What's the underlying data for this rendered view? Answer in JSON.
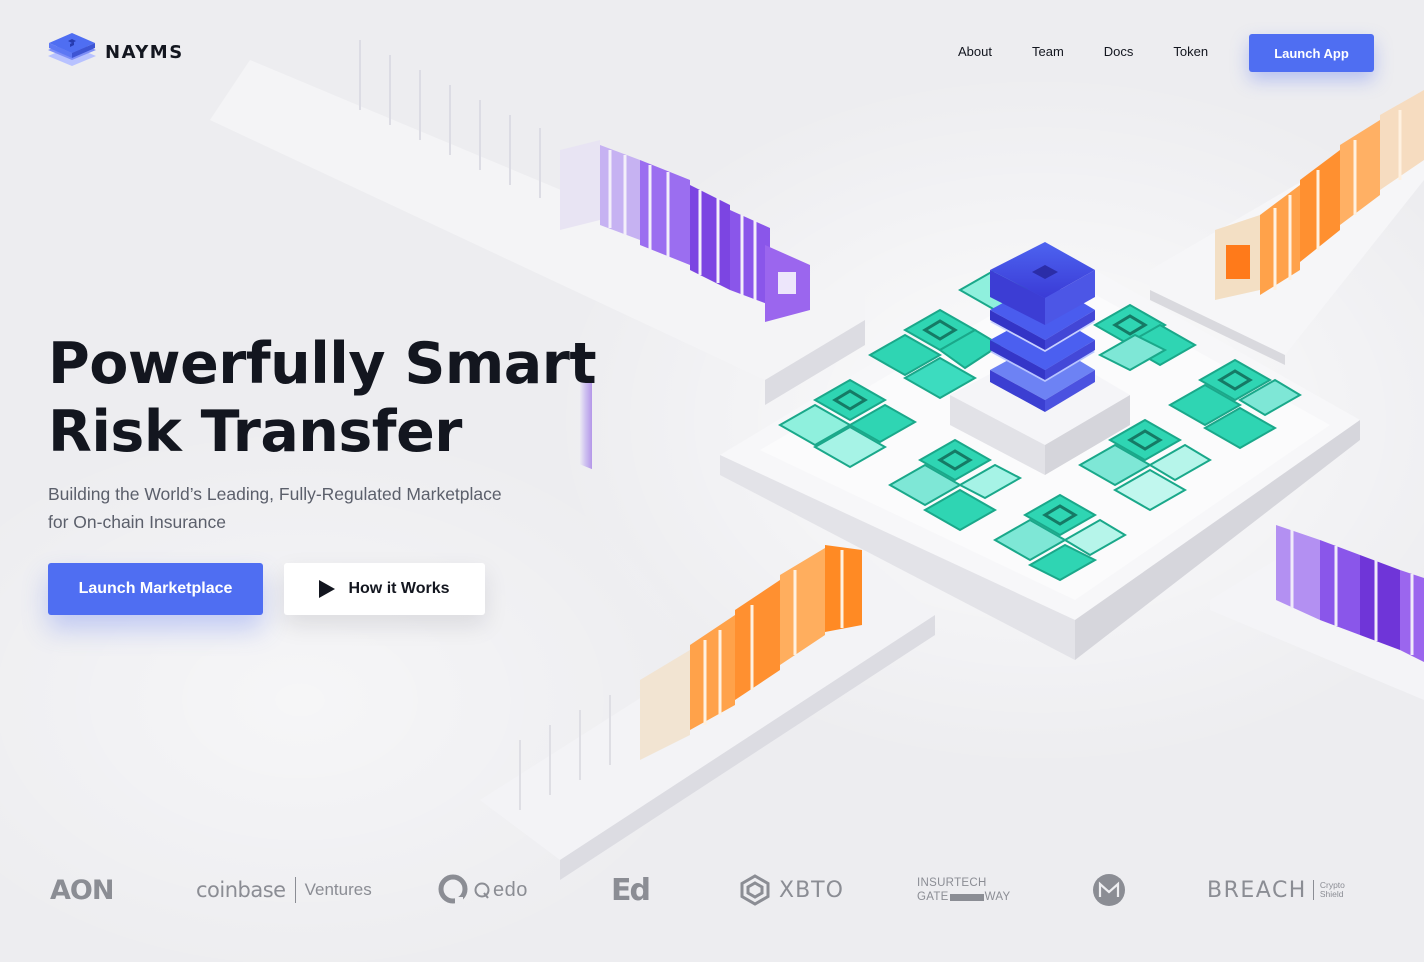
{
  "brand": {
    "name": "NAYMS",
    "accent": "#4f6ef2",
    "text_dark": "#13161f",
    "text_muted": "#5b5f6b",
    "logo_gray": "#8b8d94"
  },
  "header": {
    "nav": [
      {
        "label": "About"
      },
      {
        "label": "Team"
      },
      {
        "label": "Docs"
      },
      {
        "label": "Token"
      }
    ],
    "cta_label": "Launch App"
  },
  "hero": {
    "title_line1": "Powerfully Smart",
    "title_line2": "Risk Transfer",
    "subtitle_line1": "Building the World’s Leading, Fully-Regulated Marketplace",
    "subtitle_line2": "for On-chain Insurance",
    "primary_button": "Launch Marketplace",
    "secondary_button": "How it Works",
    "secondary_icon": "play-icon"
  },
  "partners": {
    "aon": "AON",
    "coinbase_name": "coinbase",
    "coinbase_division": "Ventures",
    "qedo": "edo",
    "ed": "Ed",
    "xbto": "XBTO",
    "insurtech_line1": "INSURTECH",
    "insurtech_line2a": "GATE",
    "insurtech_line2b": "WAY",
    "breach": "BREACH",
    "breach_sub1": "Crypto",
    "breach_sub2": "Shield"
  }
}
